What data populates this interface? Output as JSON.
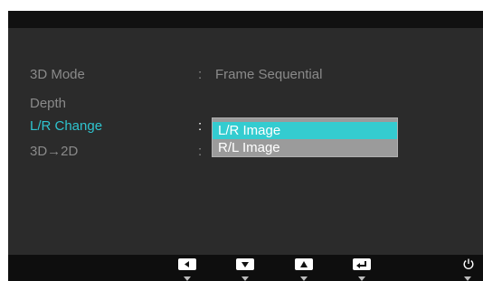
{
  "menu": {
    "rows": [
      {
        "label": "3D Mode",
        "sep": ":",
        "value": "Frame Sequential"
      },
      {
        "label": "Depth",
        "sep": "",
        "value": ""
      },
      {
        "label": "L/R Change",
        "sep": ":",
        "value": ""
      },
      {
        "label": "3D→2D",
        "sep": ":",
        "value": ""
      }
    ]
  },
  "dropdown": {
    "options": [
      "L/R Image",
      "R/L Image"
    ],
    "selected": "L/R Image"
  },
  "footer": {
    "icons": [
      "left-arrow-icon",
      "down-arrow-icon",
      "up-arrow-icon",
      "enter-icon",
      "power-icon"
    ]
  },
  "colors": {
    "accent": "#2ec4cf",
    "selection": "#34ccd0",
    "panel": "#2b2b2b",
    "text": "#8a8a8a"
  }
}
